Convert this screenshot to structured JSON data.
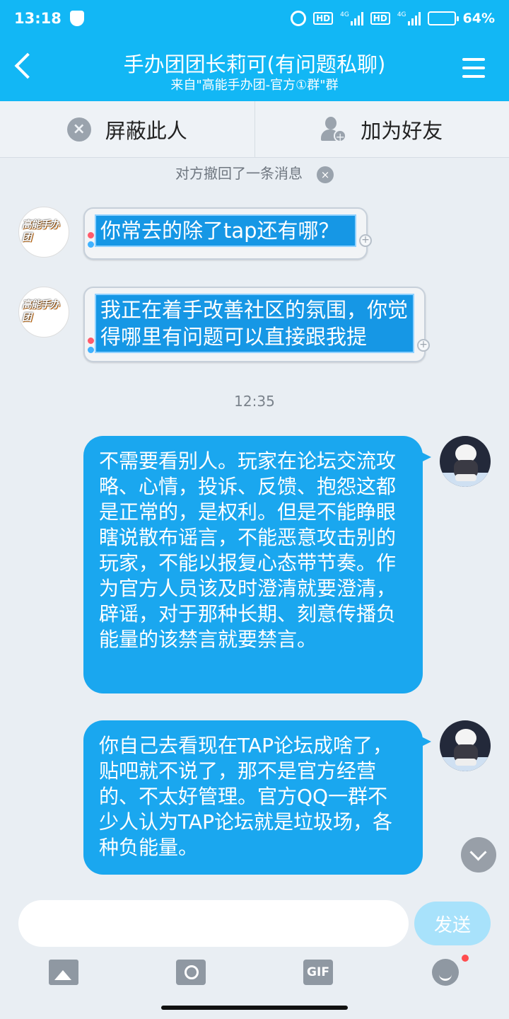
{
  "status_bar": {
    "time": "13:18",
    "hd1": "HD",
    "net1": "4G",
    "hd2": "HD",
    "net2": "4G",
    "battery_percent": "64%",
    "battery_level": 0.64
  },
  "header": {
    "title": "手办团团长莉可(有问题私聊)",
    "subtitle": "来自\"高能手办团-官方①群\"群"
  },
  "actions": {
    "block_label": "屏蔽此人",
    "add_friend_label": "加为好友"
  },
  "chat": {
    "recall_notice": "对方撤回了一条消息",
    "group_avatar_text": "高能手办团",
    "messages_in": [
      {
        "text": "你常去的除了tap还有哪？"
      },
      {
        "text": "我正在着手改善社区的氛围，你觉得哪里有问题可以直接跟我提"
      }
    ],
    "time_separator": "12:35",
    "messages_out": [
      {
        "text": "不需要看别人。玩家在论坛交流攻略、心情，投诉、反馈、抱怨这都是正常的，是权利。但是不能睁眼瞎说散布谣言，不能恶意攻击别的玩家，不能以报复心态带节奏。作为官方人员该及时澄清就要澄清，辟谣，对于那种长期、刻意传播负能量的该禁言就要禁言。"
      },
      {
        "text": "你自己去看现在TAP论坛成啥了，贴吧就不说了，那不是官方经营的、不太好管理。官方QQ一群不少人认为TAP论坛就是垃圾场，各种负能量。"
      }
    ]
  },
  "input": {
    "value": "",
    "placeholder": "",
    "send_label": "发送",
    "gif_label": "GIF"
  },
  "colors": {
    "header_blue": "#12b7f5",
    "bubble_out": "#1aa7ef",
    "send_disabled": "#a8e2fb"
  }
}
